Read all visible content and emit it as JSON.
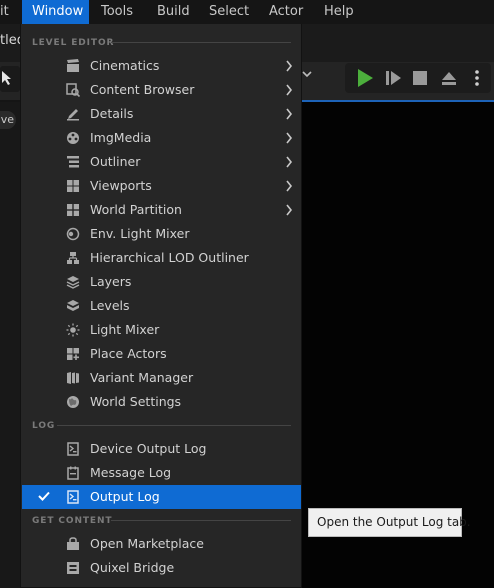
{
  "menubar": {
    "items": [
      "it",
      "Window",
      "Tools",
      "Build",
      "Select",
      "Actor",
      "Help"
    ],
    "active": "Window"
  },
  "editor": {
    "tab_title": "tled",
    "toolbar_letter": "S",
    "pill_text": "ve"
  },
  "dropdown": {
    "sections": [
      {
        "header": "LEVEL EDITOR",
        "items": [
          {
            "label": "Cinematics",
            "icon": "film-strip-icon",
            "submenu": true
          },
          {
            "label": "Content Browser",
            "icon": "content-browser-icon",
            "submenu": true
          },
          {
            "label": "Details",
            "icon": "pencil-details-icon",
            "submenu": true
          },
          {
            "label": "ImgMedia",
            "icon": "imgmedia-icon",
            "submenu": true
          },
          {
            "label": "Outliner",
            "icon": "outliner-list-icon",
            "submenu": true
          },
          {
            "label": "Viewports",
            "icon": "viewports-grid-icon",
            "submenu": true
          },
          {
            "label": "World Partition",
            "icon": "world-partition-icon",
            "submenu": true
          },
          {
            "label": "Env. Light Mixer",
            "icon": "env-light-mixer-icon",
            "submenu": false
          },
          {
            "label": "Hierarchical LOD Outliner",
            "icon": "hlod-outliner-icon",
            "submenu": false
          },
          {
            "label": "Layers",
            "icon": "layers-icon",
            "submenu": false
          },
          {
            "label": "Levels",
            "icon": "levels-icon",
            "submenu": false
          },
          {
            "label": "Light Mixer",
            "icon": "light-mixer-icon",
            "submenu": false
          },
          {
            "label": "Place Actors",
            "icon": "place-actors-icon",
            "submenu": false
          },
          {
            "label": "Variant Manager",
            "icon": "variant-manager-icon",
            "submenu": false
          },
          {
            "label": "World Settings",
            "icon": "globe-icon",
            "submenu": false
          }
        ]
      },
      {
        "header": "LOG",
        "items": [
          {
            "label": "Device Output Log",
            "icon": "device-log-icon",
            "submenu": false
          },
          {
            "label": "Message Log",
            "icon": "message-log-icon",
            "submenu": false
          },
          {
            "label": "Output Log",
            "icon": "output-log-icon",
            "submenu": false,
            "checked": true,
            "selected": true
          }
        ]
      },
      {
        "header": "GET CONTENT",
        "items": [
          {
            "label": "Open Marketplace",
            "icon": "marketplace-bag-icon",
            "submenu": false
          },
          {
            "label": "Quixel Bridge",
            "icon": "quixel-bridge-icon",
            "submenu": false
          }
        ]
      }
    ]
  },
  "tooltip": {
    "text": "Open the Output Log tab."
  },
  "colors": {
    "accent": "#0f6bd3",
    "play_green": "#4caf3c",
    "menu_bg": "#262626"
  }
}
